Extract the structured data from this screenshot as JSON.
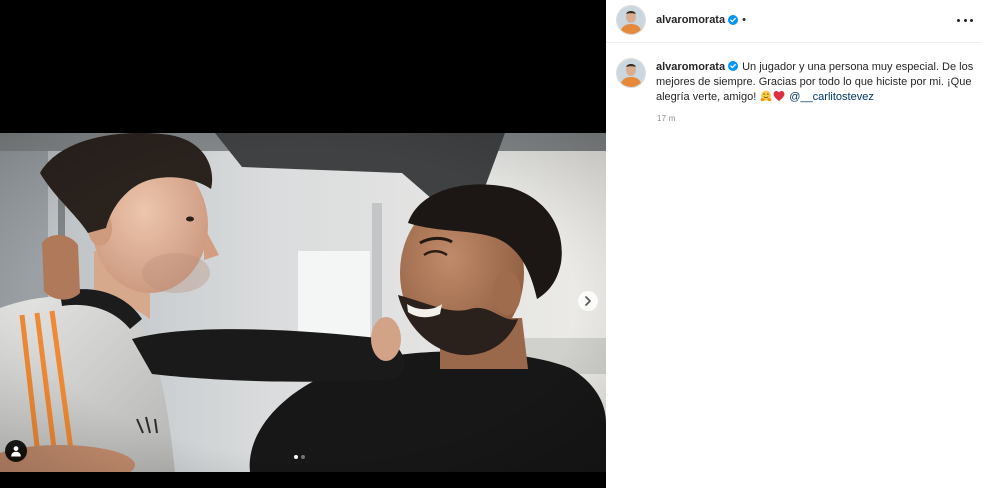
{
  "header": {
    "username": "alvaromorata",
    "verified": true,
    "separator": "•"
  },
  "caption": {
    "username": "alvaromorata",
    "verified": true,
    "text": "Un jugador y una persona muy especial. De los mejores de siempre. Gracias por todo lo que hiciste por mi. ¡Que alegría verte, amigo!",
    "emoji_icons": [
      "hugging-face-icon",
      "red-heart-icon"
    ],
    "mention": "@__carlitostevez",
    "time": "17 m"
  },
  "carousel": {
    "dot_count": 2,
    "active_dot": 1
  },
  "icons": {
    "avatar": "profile-avatar",
    "verified": "verified-badge-icon",
    "more": "more-options-icon",
    "next": "chevron-right-icon",
    "tags": "user-tag-icon"
  },
  "colors": {
    "verified": "#0095f6",
    "mention": "#00376b",
    "text": "#262626",
    "time": "#8e8e8e",
    "divider": "#efefef",
    "media_background": "#000000"
  }
}
